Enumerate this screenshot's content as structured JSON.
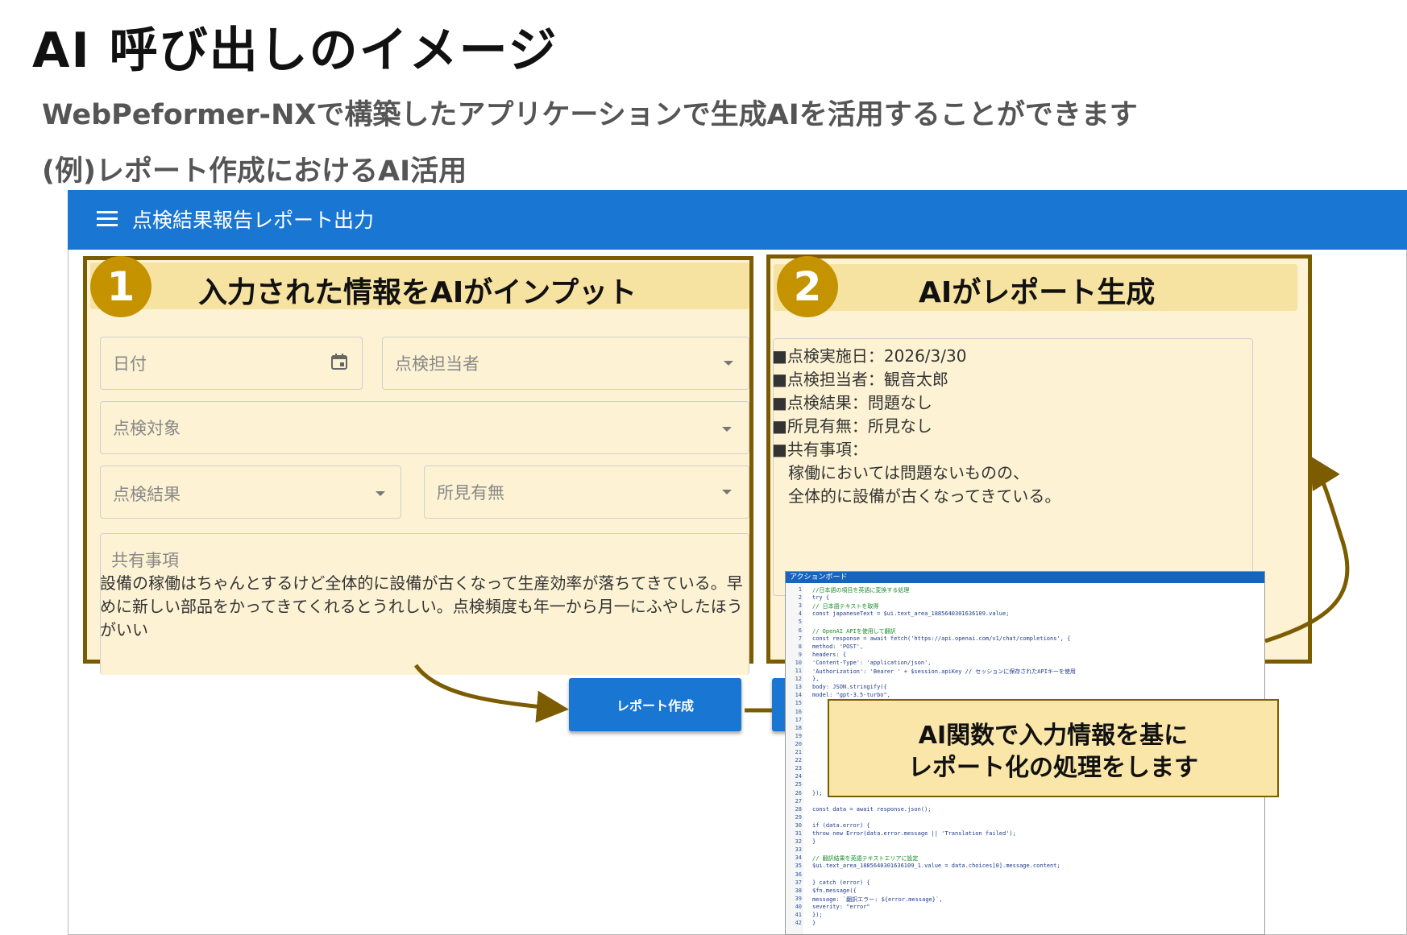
{
  "slide": {
    "title": "AI 呼び出しのイメージ",
    "subtitle": "WebPeformer-NXで構築したアプリケーションで生成AIを活用することができます",
    "example": "(例)レポート作成におけるAI活用"
  },
  "app": {
    "title": "点検結果報告レポート出力",
    "menu_icon": "hamburger-menu-icon",
    "header_color": "#1976d2"
  },
  "step1": {
    "number": "1",
    "label": "入力された情報をAIがインプット",
    "fields": {
      "date": "日付",
      "inspector": "点検担当者",
      "target": "点検対象",
      "result": "点検結果",
      "findings": "所見有無",
      "shared": "共有事項"
    },
    "shared_text": "設備の稼働はちゃんとするけど全体的に設備が古くなって生産効率が落ちてきている。早めに新しい部品をかってきてくれるとうれしい。点検頻度も年一から月一にふやしたほうがいい"
  },
  "step2": {
    "number": "2",
    "label": "AIがレポート生成",
    "report": [
      "■点検実施日：2026/3/30",
      "■点検担当者：観音太郎",
      "■点検結果：問題なし",
      "■所見有無：所見なし",
      "■共有事項：",
      "　稼働においては問題ないものの、",
      "　全体的に設備が古くなってきている。"
    ]
  },
  "buttons": {
    "report": "レポート作成"
  },
  "action_board": {
    "title": "アクションボード",
    "lines": [
      {
        "n": "1",
        "t": "  //日本語の項目を英語に変換する処理",
        "c": true
      },
      {
        "n": "2",
        "t": "  try {"
      },
      {
        "n": "3",
        "t": "    // 日本語テキストを取得",
        "c": true
      },
      {
        "n": "4",
        "t": "    const japaneseText = $ui.text_area_1885640301636109.value;"
      },
      {
        "n": "5",
        "t": ""
      },
      {
        "n": "6",
        "t": "    // OpenAI APIを使用して翻訳",
        "c": true
      },
      {
        "n": "7",
        "t": "    const response = await fetch('https://api.openai.com/v1/chat/completions', {"
      },
      {
        "n": "8",
        "t": "      method: 'POST',"
      },
      {
        "n": "9",
        "t": "      headers: {"
      },
      {
        "n": "10",
        "t": "        'Content-Type': 'application/json',"
      },
      {
        "n": "11",
        "t": "        'Authorization': 'Bearer ' + $session.apiKey // セッションに保存されたAPIキーを使用"
      },
      {
        "n": "12",
        "t": "      },"
      },
      {
        "n": "13",
        "t": "      body: JSON.stringify({"
      },
      {
        "n": "14",
        "t": "        model: \"gpt-3.5-turbo\","
      },
      {
        "n": "15",
        "t": ""
      },
      {
        "n": "16",
        "t": ""
      },
      {
        "n": "17",
        "t": ""
      },
      {
        "n": "18",
        "t": ""
      },
      {
        "n": "19",
        "t": ""
      },
      {
        "n": "20",
        "t": ""
      },
      {
        "n": "21",
        "t": ""
      },
      {
        "n": "22",
        "t": ""
      },
      {
        "n": "23",
        "t": ""
      },
      {
        "n": "24",
        "t": ""
      },
      {
        "n": "25",
        "t": ""
      },
      {
        "n": "26",
        "t": "  });"
      },
      {
        "n": "27",
        "t": ""
      },
      {
        "n": "28",
        "t": "    const data = await response.json();"
      },
      {
        "n": "29",
        "t": ""
      },
      {
        "n": "30",
        "t": "    if (data.error) {"
      },
      {
        "n": "31",
        "t": "      throw new Error(data.error.message || 'Translation failed');"
      },
      {
        "n": "32",
        "t": "    }"
      },
      {
        "n": "33",
        "t": ""
      },
      {
        "n": "34",
        "t": "    // 翻訳結果を英語テキストエリアに設定",
        "c": true
      },
      {
        "n": "35",
        "t": "    $ui.text_area_1885640301636109_1.value = data.choices[0].message.content;"
      },
      {
        "n": "36",
        "t": ""
      },
      {
        "n": "37",
        "t": "  } catch (error) {"
      },
      {
        "n": "38",
        "t": "    $fn.message({"
      },
      {
        "n": "39",
        "t": "      message: `翻訳エラー: ${error.message}`,"
      },
      {
        "n": "40",
        "t": "      severity: \"error\""
      },
      {
        "n": "41",
        "t": "    });"
      },
      {
        "n": "42",
        "t": "  }"
      }
    ]
  },
  "callout": {
    "line1": "AI関数で入力情報を基に",
    "line2": "レポート化の処理をします"
  },
  "colors": {
    "accent_blue": "#1976d2",
    "panel_border": "#7b5c00",
    "panel_fill": "#fdf3d4",
    "banner_fill": "#f7e3a1",
    "number_circle": "#c59200"
  }
}
